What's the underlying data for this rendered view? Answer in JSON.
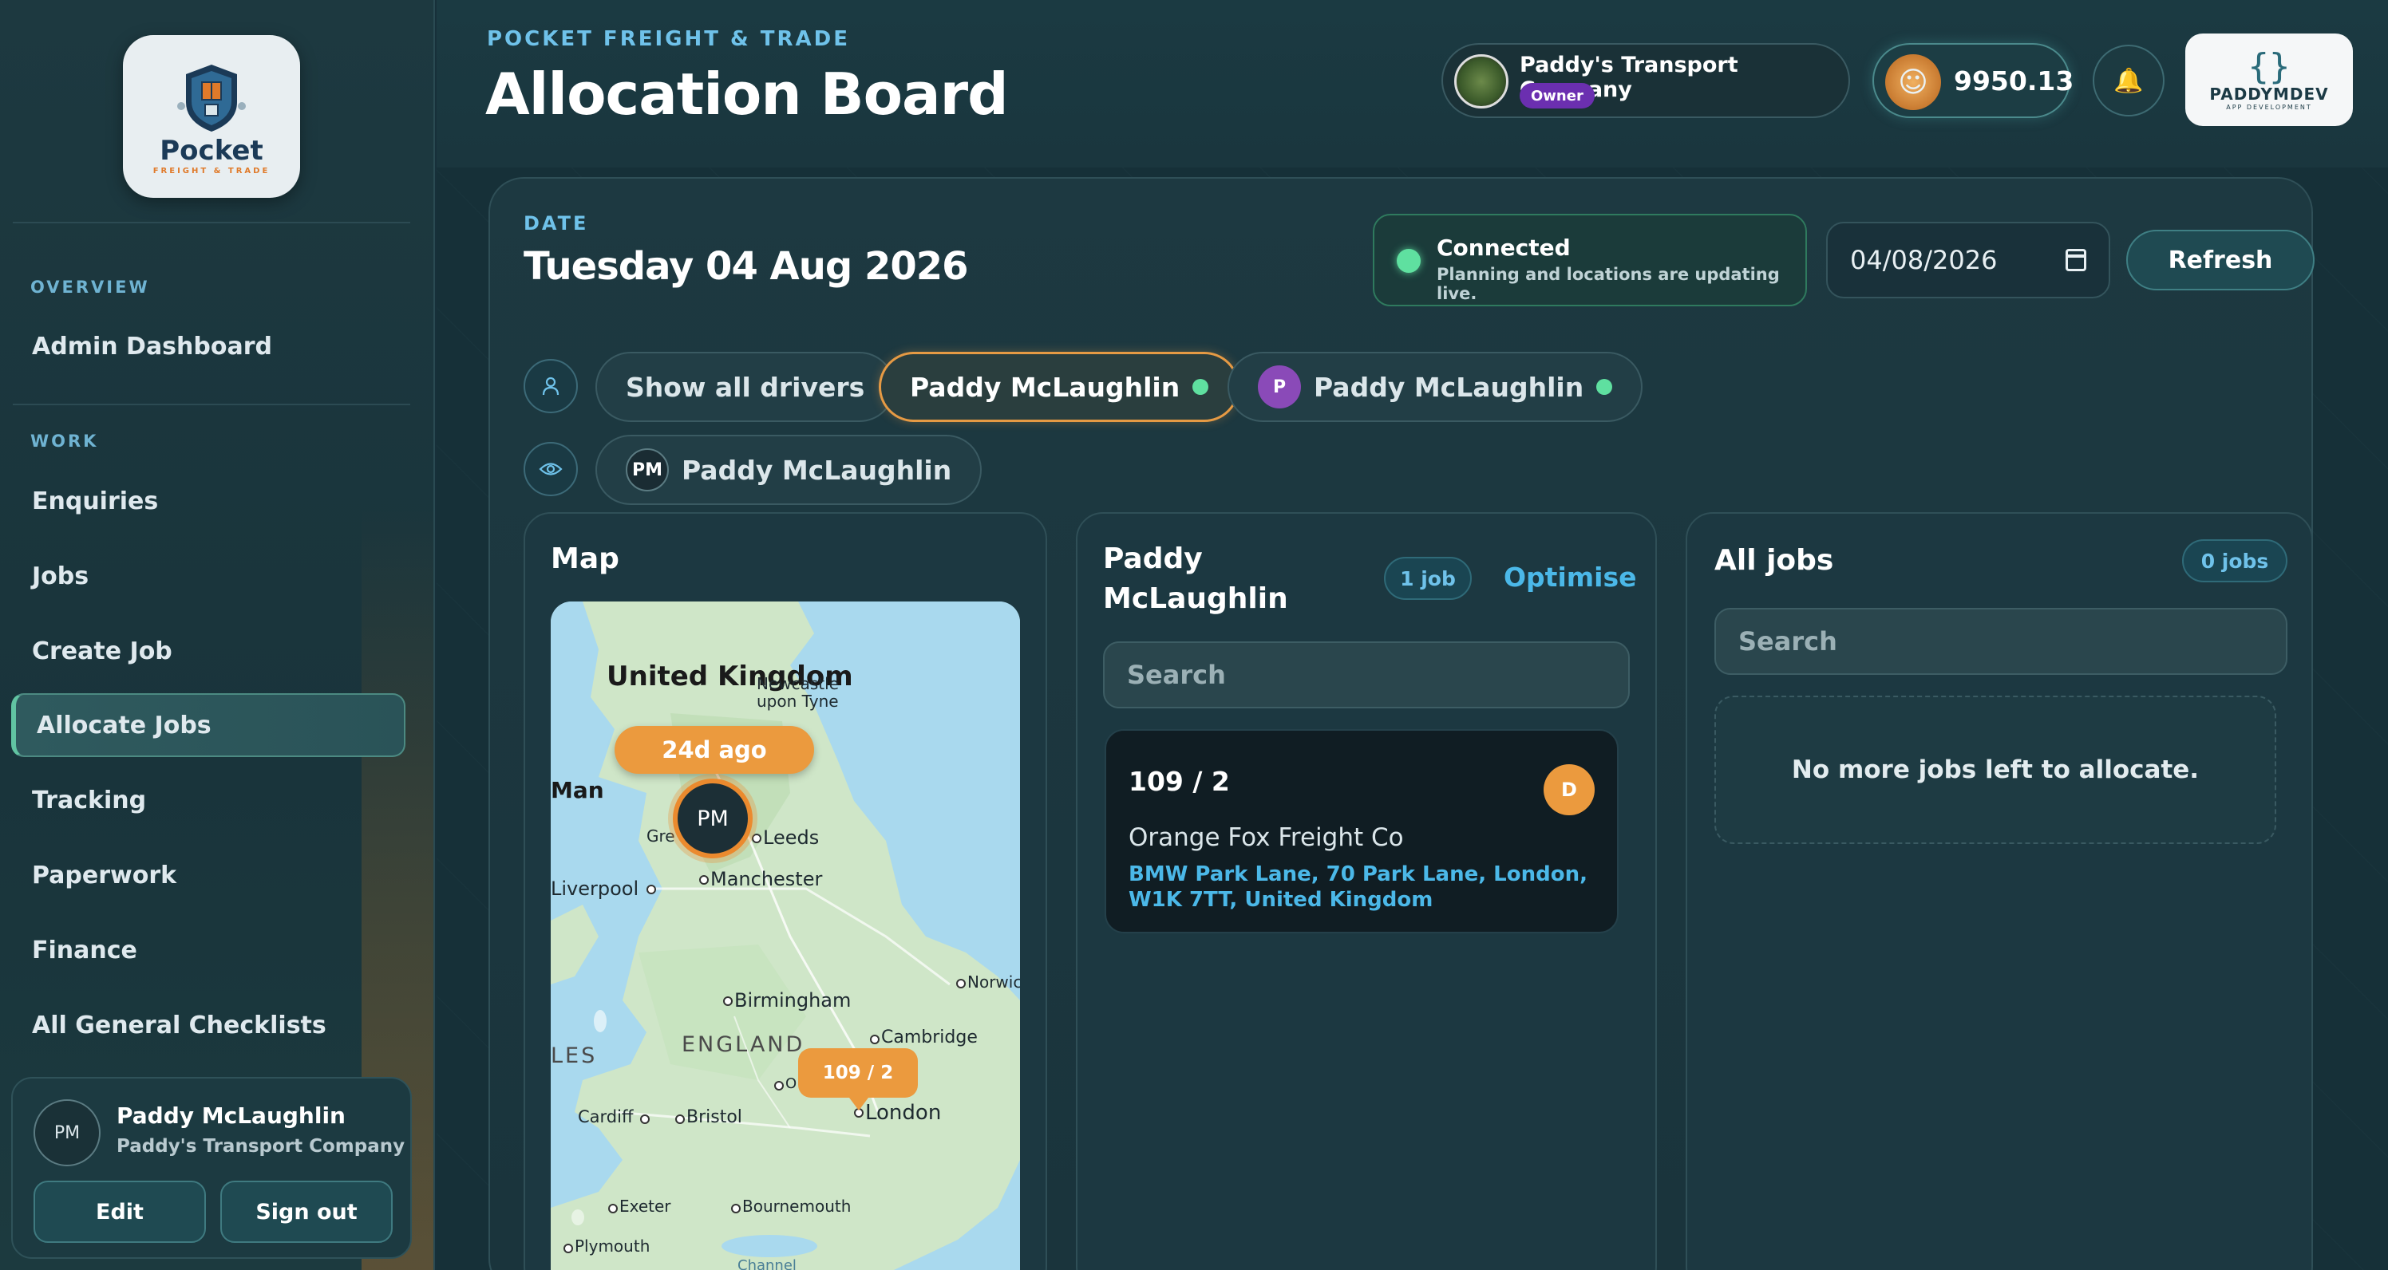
{
  "brand": {
    "logo_word": "Pocket",
    "logo_sub": "FREIGHT & TRADE"
  },
  "sidebar": {
    "sections": [
      {
        "label": "OVERVIEW",
        "items": [
          {
            "label": "Admin Dashboard"
          }
        ]
      },
      {
        "label": "WORK",
        "items": [
          {
            "label": "Enquiries"
          },
          {
            "label": "Jobs"
          },
          {
            "label": "Create Job"
          },
          {
            "label": "Allocate Jobs",
            "active": true
          },
          {
            "label": "Tracking"
          },
          {
            "label": "Paperwork"
          },
          {
            "label": "Finance"
          },
          {
            "label": "All General Checklists"
          }
        ]
      }
    ],
    "user": {
      "initials": "PM",
      "name": "Paddy McLaughlin",
      "company": "Paddy's Transport Company",
      "edit_label": "Edit",
      "signout_label": "Sign out"
    }
  },
  "header": {
    "eyebrow": "POCKET FREIGHT & TRADE",
    "title": "Allocation Board",
    "company": {
      "name": "Paddy's Transport Company",
      "role": "Owner"
    },
    "balance": "9950.13",
    "bell_icon": "bell-icon",
    "dev_badge": {
      "name": "PADDYMDEV",
      "sub": "APP DEVELOPMENT"
    }
  },
  "board": {
    "date_label": "DATE",
    "date_value": "Tuesday 04 Aug 2026",
    "status": {
      "title": "Connected",
      "subtitle": "Planning and locations are updating live.",
      "color": "#5fe0a0"
    },
    "date_input": "04/08/2026",
    "refresh_label": "Refresh",
    "driver_chips": [
      {
        "label": "Show all drivers",
        "selected": false
      },
      {
        "label": "Paddy McLaughlin",
        "selected": true,
        "online": true
      },
      {
        "label": "Paddy McLaughlin",
        "avatar": "P",
        "online": true
      }
    ],
    "viewer_chip": {
      "avatar": "PM",
      "label": "Paddy McLaughlin"
    },
    "map": {
      "title": "Map",
      "driver_last_seen": "24d ago",
      "driver_initials": "PM",
      "job_pin": "109 / 2",
      "labels": [
        "United Kingdom",
        "Newcastle upon Tyne",
        "Man",
        "Gre",
        "Leeds",
        "Liverpool",
        "Manchester",
        "Norwic",
        "Birmingham",
        "Cambridge",
        "LES",
        "ENGLAND",
        "O",
        "London",
        "Cardiff",
        "Bristol",
        "Exeter",
        "Bournemouth",
        "Plymouth",
        "Channel"
      ]
    },
    "driver_column": {
      "title": "Paddy McLaughlin",
      "count": "1 job",
      "optimise_label": "Optimise",
      "search_placeholder": "Search",
      "jobs": [
        {
          "ref": "109 / 2",
          "badge": "D",
          "customer": "Orange Fox Freight Co",
          "address": "BMW Park Lane, 70 Park Lane, London, W1K 7TT, United Kingdom"
        }
      ]
    },
    "all_jobs": {
      "title": "All jobs",
      "count": "0 jobs",
      "search_placeholder": "Search",
      "empty_message": "No more jobs left to allocate."
    }
  }
}
